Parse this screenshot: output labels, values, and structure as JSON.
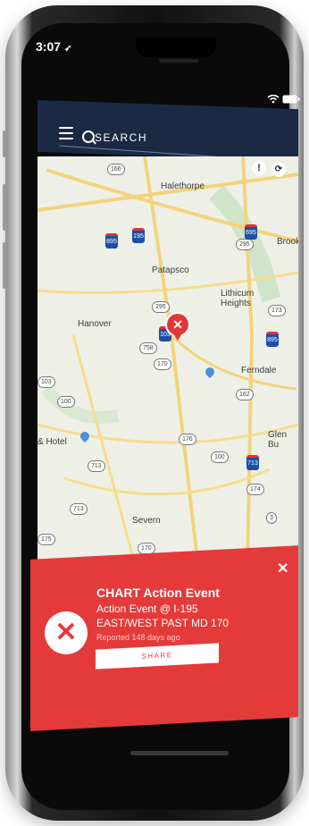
{
  "status": {
    "time": "3:07",
    "time_arrow": "➶"
  },
  "header": {
    "search_label": "SEARCH",
    "info_label": "!",
    "refresh_label": "⟳"
  },
  "map": {
    "places": [
      {
        "name": "Halethorpe"
      },
      {
        "name": "Patapsco"
      },
      {
        "name": "Lithicum\nHeights"
      },
      {
        "name": "Hanover"
      },
      {
        "name": "Ferndale"
      },
      {
        "name": "& Hotel"
      },
      {
        "name": "Glen Bu"
      },
      {
        "name": "Severn"
      },
      {
        "name": "Brook"
      }
    ],
    "routes": [
      "166",
      "895",
      "195",
      "295",
      "695",
      "758",
      "295",
      "170",
      "100",
      "162",
      "176",
      "100",
      "713",
      "713",
      "175",
      "174",
      "170",
      "3",
      "103",
      "173",
      "713",
      "895",
      "103"
    ]
  },
  "alert": {
    "title": "CHART Action Event",
    "line1": "Action Event @ I-195",
    "line2": "EAST/WEST PAST MD 170",
    "reported": "Reported 148 days ago",
    "share_label": "SHARE",
    "close_label": "✕",
    "icon_label": "✕",
    "color": "#e53a3a"
  }
}
